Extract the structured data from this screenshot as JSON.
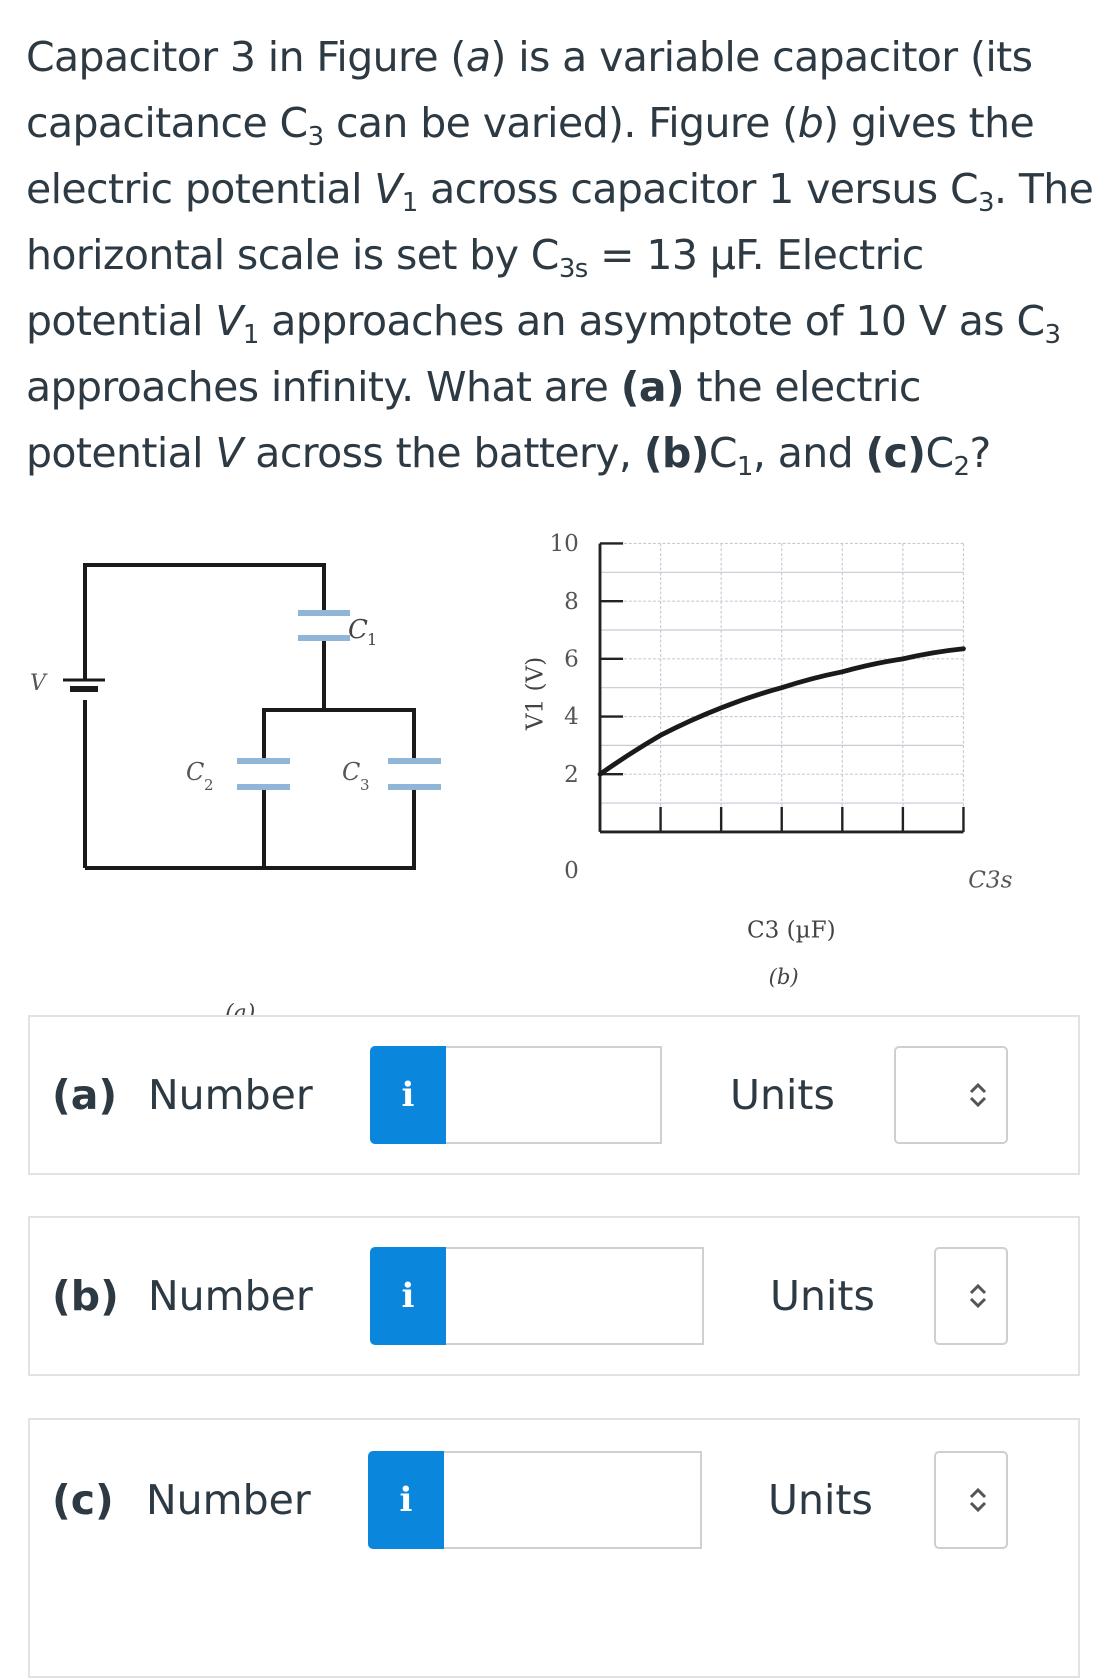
{
  "question": {
    "line1": "Capacitor 3 in Figure (",
    "line1_fig": "a",
    "line1_end": ") is a variable capacitor (its capacitance C",
    "sub3": "3",
    "line2_end": " can be varied). Figure (",
    "line2_fig": "b",
    "line2_tail": ") gives the electric potential ",
    "V": "V",
    "sub1": "1",
    "seg_across": " across capacitor 1 versus C",
    "seg_scale": ". The horizontal scale is set by C",
    "sub3s": "3s",
    "seg_value": " = 13 µF. Electric potential ",
    "seg_asym": " approaches an asymptote of 10 V as C",
    "seg_inf": " approaches infinity. What are ",
    "part_a": "(a)",
    "seg_battery": " the electric potential ",
    "seg_battery2": " across the battery, ",
    "part_b": "(b)",
    "c1": "C",
    "seg_and": ", and ",
    "part_c": "(c)",
    "sub2": "2",
    "seg_q": "?"
  },
  "figure_a": {
    "caption": "(a)",
    "battery_label": "V",
    "c1_label": "C",
    "c1_sub": "1",
    "c2_label": "C",
    "c2_sub": "2",
    "c3_label": "C",
    "c3_sub": "3",
    "plate_color": "#8fb6d6",
    "wire_color": "#1a1a1a"
  },
  "chart_data": {
    "type": "line",
    "title": "",
    "caption": "(b)",
    "xlabel": "C3 (µF)",
    "ylabel": "V1 (V)",
    "x_tick_labels": [
      "0",
      "C3s"
    ],
    "x_domain_note": "x axis spans 0 to C3s = 13 µF, 6 divisions",
    "xlim": [
      0,
      13
    ],
    "ylim": [
      0,
      10
    ],
    "y_ticks": [
      0,
      2,
      4,
      6,
      8,
      10
    ],
    "y_tick_labels": [
      "0",
      "2",
      "4",
      "6",
      "8",
      "10"
    ],
    "grid": true,
    "series": [
      {
        "name": "V1",
        "x": [
          0,
          2.1667,
          4.3333,
          6.5,
          8.6667,
          10.8333,
          13
        ],
        "y": [
          2.0,
          3.35,
          4.3,
          5.0,
          5.55,
          6.0,
          6.35
        ]
      }
    ],
    "asymptote": 10
  },
  "answers": [
    {
      "part": "(a)",
      "number_label": "Number",
      "info_icon": "i",
      "value": "",
      "units_label": "Units",
      "units_value": ""
    },
    {
      "part": "(b)",
      "number_label": "Number",
      "info_icon": "i",
      "value": "",
      "units_label": "Units",
      "units_value": ""
    },
    {
      "part": "(c)",
      "number_label": "Number",
      "info_icon": "i",
      "value": "",
      "units_label": "Units",
      "units_value": ""
    }
  ],
  "colors": {
    "info_button": "#0a87dc",
    "text": "#2d3a43"
  }
}
